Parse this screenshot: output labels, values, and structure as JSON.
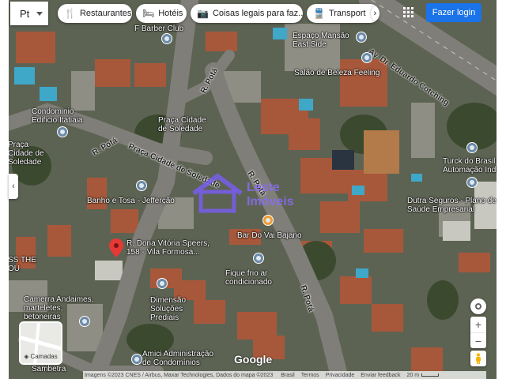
{
  "search": {
    "value": "Pt",
    "dropdown_icon": "chevron-down-icon"
  },
  "chips": [
    {
      "icon": "fork-knife-icon",
      "label": "Restaurantes"
    },
    {
      "icon": "bed-icon",
      "label": "Hotéis"
    },
    {
      "icon": "camera-icon",
      "label": "Coisas legais para faz..."
    },
    {
      "icon": "train-icon",
      "label": "Transport"
    }
  ],
  "chip_next_icon": "chevron-right-icon",
  "apps_icon": "grid-icon",
  "login_label": "Fazer login",
  "side_toggle_icon": "chevron-left-icon",
  "layers": {
    "label": "Camadas",
    "icon": "layers-icon"
  },
  "google_logo": "Google",
  "footer": {
    "attribution": "Imagens ©2023 CNES / Airbus, Maxar Technologies, Dados do mapa ©2023",
    "links": [
      "Brasil",
      "Termos",
      "Privacidade",
      "Enviar feedback"
    ],
    "scale": "20 m"
  },
  "controls": {
    "locate_icon": "locate-icon",
    "zoom_in": "+",
    "zoom_out": "−",
    "pegman_icon": "pegman-icon"
  },
  "watermark": "Leste Imóveis",
  "roads": [
    "Av. Dr. Eduardo Cotching",
    "R. Potá",
    "Praça Cidade de Soledade",
    "R. Potá",
    "R. Potá",
    "R. Potá",
    "R. Dona Vitória Speers, 158 - Vila Formosa..."
  ],
  "places": [
    "F Barber Club",
    "Espaço Mansão East Side",
    "Salão de Beleza Feeling",
    "Condominio Edificio Itatiaia",
    "Praça Cidade de Soledade",
    "Praça Cidade de Soledade",
    "Banho e Tosa - Jefferção",
    "Turck do Brasil Automação Indus",
    "Dutra Seguros - Plano de Saúde Empresarial",
    "Bar Do Vai Bajano",
    "Fique frio ar condicionado",
    "SS THE OU",
    "Camerra Andaimes, marteletes, betoneiras",
    "Dimensão Soluções Prediais",
    "Amici Administração de Condomínios",
    "Sambetra"
  ]
}
